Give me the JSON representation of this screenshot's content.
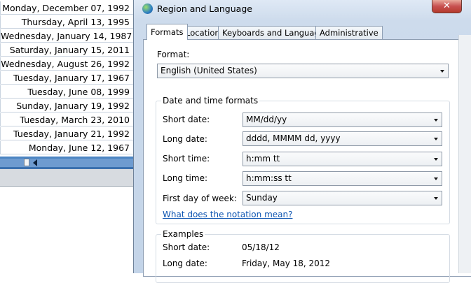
{
  "background_sheet": {
    "dates": [
      "Monday, December 07, 1992",
      "Thursday, April 13, 1995",
      "Wednesday, January 14, 1987",
      "Saturday, January 15, 2011",
      "Wednesday, August 26, 1992",
      "Tuesday, January 17, 1967",
      "Tuesday, June 08, 1999",
      "Sunday, January 19, 1992",
      "Tuesday, March 23, 2010",
      "Tuesday, January 21, 1992",
      "Monday, June 12, 1967"
    ]
  },
  "dialog": {
    "title": "Region and Language",
    "close_label": "✕",
    "tabs": [
      "Formats",
      "Location",
      "Keyboards and Languages",
      "Administrative"
    ],
    "active_tab": "Formats",
    "format": {
      "label": "Format:",
      "value": "English (United States)"
    },
    "date_time_group": {
      "title": "Date and time formats",
      "short_date": {
        "label": "Short date:",
        "value": "MM/dd/yy"
      },
      "long_date": {
        "label": "Long date:",
        "value": "dddd, MMMM dd, yyyy"
      },
      "short_time": {
        "label": "Short time:",
        "value": "h:mm tt"
      },
      "long_time": {
        "label": "Long time:",
        "value": "h:mm:ss tt"
      },
      "first_day": {
        "label": "First day of week:",
        "value": "Sunday"
      },
      "notation_link": "What does the notation mean?"
    },
    "examples_group": {
      "title": "Examples",
      "short_date": {
        "label": "Short date:",
        "value": "05/18/12"
      },
      "long_date": {
        "label": "Long date:",
        "value": "Friday, May 18, 2012"
      }
    }
  }
}
